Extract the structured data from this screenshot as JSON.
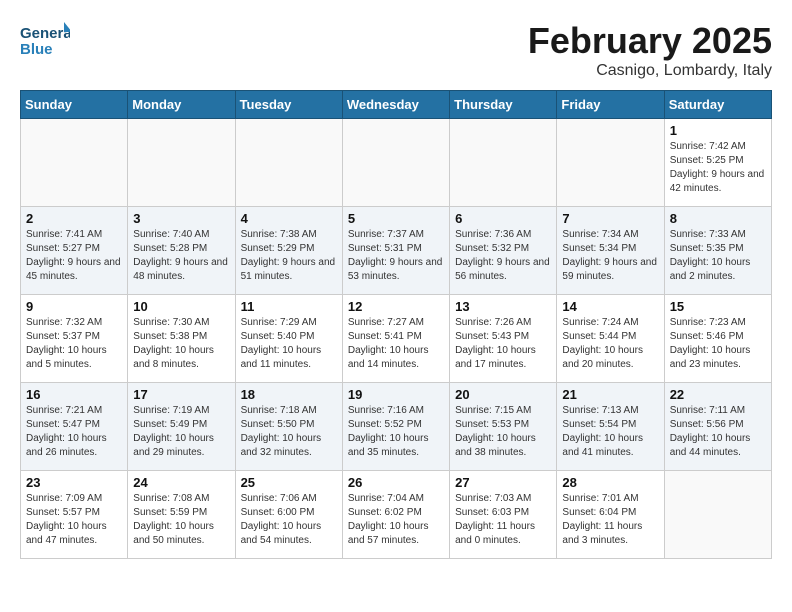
{
  "header": {
    "logo_general": "General",
    "logo_blue": "Blue",
    "month_year": "February 2025",
    "location": "Casnigo, Lombardy, Italy"
  },
  "weekdays": [
    "Sunday",
    "Monday",
    "Tuesday",
    "Wednesday",
    "Thursday",
    "Friday",
    "Saturday"
  ],
  "weeks": [
    [
      {
        "day": "",
        "info": ""
      },
      {
        "day": "",
        "info": ""
      },
      {
        "day": "",
        "info": ""
      },
      {
        "day": "",
        "info": ""
      },
      {
        "day": "",
        "info": ""
      },
      {
        "day": "",
        "info": ""
      },
      {
        "day": "1",
        "info": "Sunrise: 7:42 AM\nSunset: 5:25 PM\nDaylight: 9 hours and 42 minutes."
      }
    ],
    [
      {
        "day": "2",
        "info": "Sunrise: 7:41 AM\nSunset: 5:27 PM\nDaylight: 9 hours and 45 minutes."
      },
      {
        "day": "3",
        "info": "Sunrise: 7:40 AM\nSunset: 5:28 PM\nDaylight: 9 hours and 48 minutes."
      },
      {
        "day": "4",
        "info": "Sunrise: 7:38 AM\nSunset: 5:29 PM\nDaylight: 9 hours and 51 minutes."
      },
      {
        "day": "5",
        "info": "Sunrise: 7:37 AM\nSunset: 5:31 PM\nDaylight: 9 hours and 53 minutes."
      },
      {
        "day": "6",
        "info": "Sunrise: 7:36 AM\nSunset: 5:32 PM\nDaylight: 9 hours and 56 minutes."
      },
      {
        "day": "7",
        "info": "Sunrise: 7:34 AM\nSunset: 5:34 PM\nDaylight: 9 hours and 59 minutes."
      },
      {
        "day": "8",
        "info": "Sunrise: 7:33 AM\nSunset: 5:35 PM\nDaylight: 10 hours and 2 minutes."
      }
    ],
    [
      {
        "day": "9",
        "info": "Sunrise: 7:32 AM\nSunset: 5:37 PM\nDaylight: 10 hours and 5 minutes."
      },
      {
        "day": "10",
        "info": "Sunrise: 7:30 AM\nSunset: 5:38 PM\nDaylight: 10 hours and 8 minutes."
      },
      {
        "day": "11",
        "info": "Sunrise: 7:29 AM\nSunset: 5:40 PM\nDaylight: 10 hours and 11 minutes."
      },
      {
        "day": "12",
        "info": "Sunrise: 7:27 AM\nSunset: 5:41 PM\nDaylight: 10 hours and 14 minutes."
      },
      {
        "day": "13",
        "info": "Sunrise: 7:26 AM\nSunset: 5:43 PM\nDaylight: 10 hours and 17 minutes."
      },
      {
        "day": "14",
        "info": "Sunrise: 7:24 AM\nSunset: 5:44 PM\nDaylight: 10 hours and 20 minutes."
      },
      {
        "day": "15",
        "info": "Sunrise: 7:23 AM\nSunset: 5:46 PM\nDaylight: 10 hours and 23 minutes."
      }
    ],
    [
      {
        "day": "16",
        "info": "Sunrise: 7:21 AM\nSunset: 5:47 PM\nDaylight: 10 hours and 26 minutes."
      },
      {
        "day": "17",
        "info": "Sunrise: 7:19 AM\nSunset: 5:49 PM\nDaylight: 10 hours and 29 minutes."
      },
      {
        "day": "18",
        "info": "Sunrise: 7:18 AM\nSunset: 5:50 PM\nDaylight: 10 hours and 32 minutes."
      },
      {
        "day": "19",
        "info": "Sunrise: 7:16 AM\nSunset: 5:52 PM\nDaylight: 10 hours and 35 minutes."
      },
      {
        "day": "20",
        "info": "Sunrise: 7:15 AM\nSunset: 5:53 PM\nDaylight: 10 hours and 38 minutes."
      },
      {
        "day": "21",
        "info": "Sunrise: 7:13 AM\nSunset: 5:54 PM\nDaylight: 10 hours and 41 minutes."
      },
      {
        "day": "22",
        "info": "Sunrise: 7:11 AM\nSunset: 5:56 PM\nDaylight: 10 hours and 44 minutes."
      }
    ],
    [
      {
        "day": "23",
        "info": "Sunrise: 7:09 AM\nSunset: 5:57 PM\nDaylight: 10 hours and 47 minutes."
      },
      {
        "day": "24",
        "info": "Sunrise: 7:08 AM\nSunset: 5:59 PM\nDaylight: 10 hours and 50 minutes."
      },
      {
        "day": "25",
        "info": "Sunrise: 7:06 AM\nSunset: 6:00 PM\nDaylight: 10 hours and 54 minutes."
      },
      {
        "day": "26",
        "info": "Sunrise: 7:04 AM\nSunset: 6:02 PM\nDaylight: 10 hours and 57 minutes."
      },
      {
        "day": "27",
        "info": "Sunrise: 7:03 AM\nSunset: 6:03 PM\nDaylight: 11 hours and 0 minutes."
      },
      {
        "day": "28",
        "info": "Sunrise: 7:01 AM\nSunset: 6:04 PM\nDaylight: 11 hours and 3 minutes."
      },
      {
        "day": "",
        "info": ""
      }
    ]
  ]
}
